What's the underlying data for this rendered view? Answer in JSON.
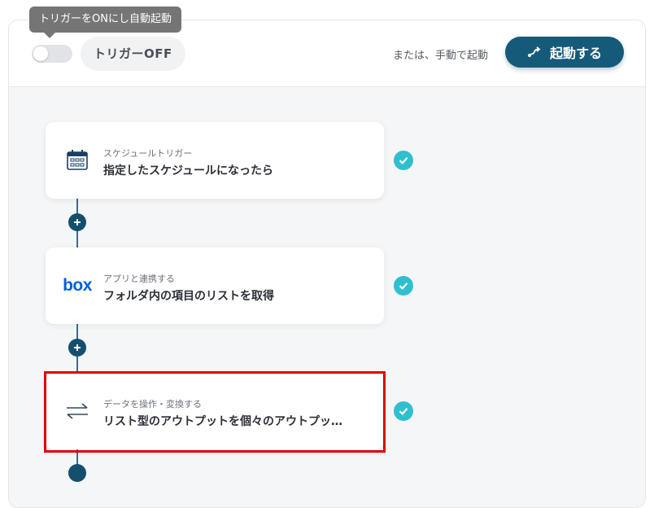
{
  "tooltip": {
    "text": "トリガーをONにし自動起動"
  },
  "header": {
    "trigger_status": "トリガーOFF",
    "manual_label": "または、手動で起動",
    "start_button_label": "起動する"
  },
  "steps": [
    {
      "kind": "スケジュールトリガー",
      "title": "指定したスケジュールになったら",
      "icon": "calendar-schedule-icon",
      "status": "complete"
    },
    {
      "kind": "アプリと連携する",
      "title": "フォルダ内の項目のリストを取得",
      "icon": "box-logo",
      "logo_text": "box",
      "status": "complete"
    },
    {
      "kind": "データを操作・変換する",
      "title": "リスト型のアウトプットを個々のアウトプッ…",
      "icon": "transform-arrows-icon",
      "status": "complete"
    }
  ],
  "colors": {
    "accent": "#165a7a",
    "check": "#2fc0cf",
    "highlight": "#e00000",
    "box_brand": "#0061d5"
  }
}
